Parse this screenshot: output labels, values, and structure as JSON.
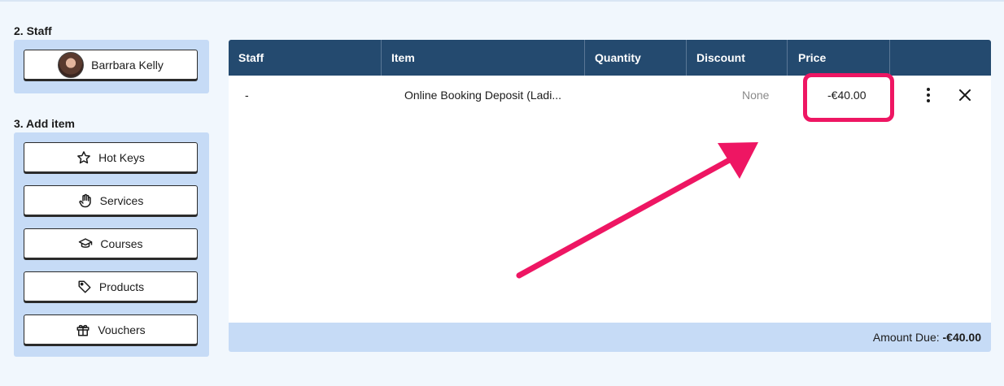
{
  "staff_section": {
    "heading": "2. Staff",
    "selected_staff": "Barrbara Kelly"
  },
  "add_item_section": {
    "heading": "3. Add item",
    "buttons": [
      {
        "label": "Hot Keys",
        "icon": "star-icon"
      },
      {
        "label": "Services",
        "icon": "hand-icon"
      },
      {
        "label": "Courses",
        "icon": "graduation-cap-icon"
      },
      {
        "label": "Products",
        "icon": "tag-icon"
      },
      {
        "label": "Vouchers",
        "icon": "gift-icon"
      }
    ]
  },
  "table": {
    "headers": [
      "Staff",
      "Item",
      "Quantity",
      "Discount",
      "Price"
    ],
    "rows": [
      {
        "staff": "-",
        "item": "Online Booking Deposit (Ladi...",
        "quantity": "",
        "discount": "None",
        "price": "-€40.00"
      }
    ]
  },
  "footer": {
    "amount_due_label": "Amount Due:",
    "amount_due_value": "-€40.00"
  },
  "colors": {
    "header_bg": "#244a6f",
    "panel_bg": "#c6dbf6",
    "highlight": "#ee1663"
  }
}
